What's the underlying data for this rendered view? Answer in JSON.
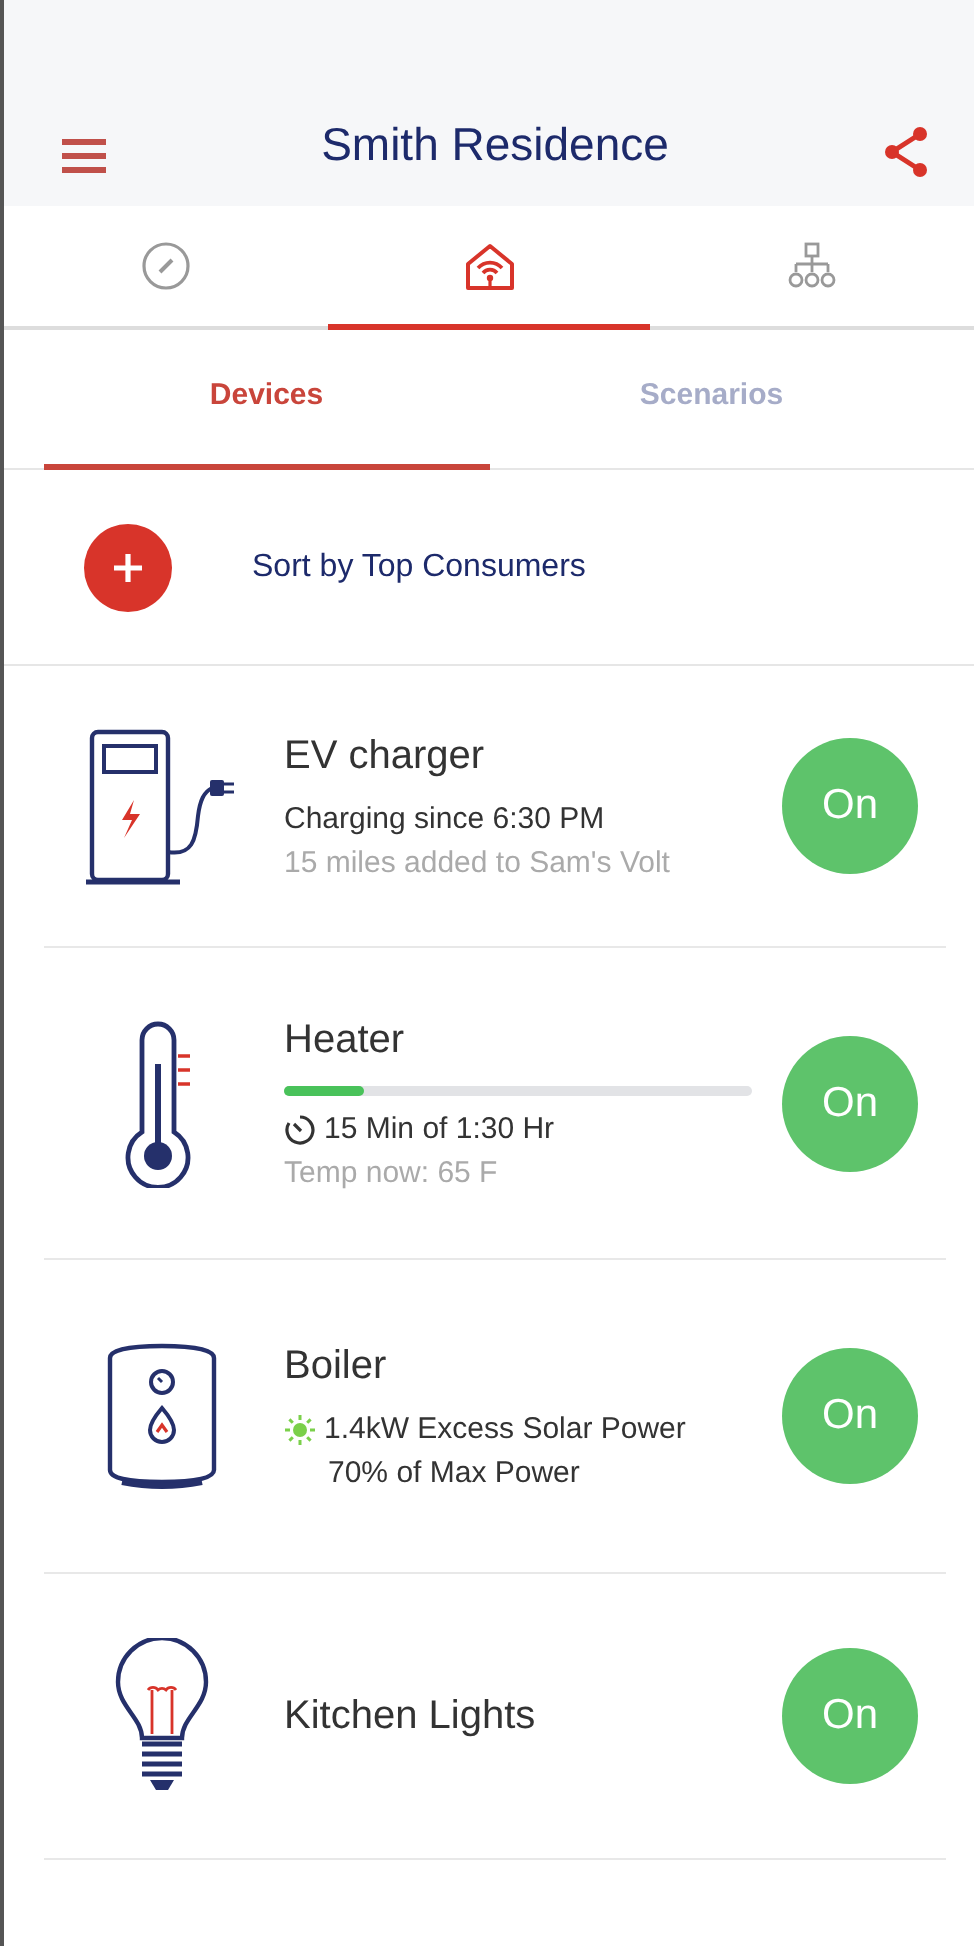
{
  "header": {
    "title": "Smith Residence"
  },
  "nav_tabs": [
    {
      "kind": "gauge",
      "selected": false
    },
    {
      "kind": "home",
      "selected": true
    },
    {
      "kind": "network",
      "selected": false
    }
  ],
  "sub_tabs": [
    {
      "label": "Devices",
      "selected": true
    },
    {
      "label": "Scenarios",
      "selected": false
    }
  ],
  "sort": {
    "label": "Sort by Top Consumers"
  },
  "devices": [
    {
      "kind": "charger",
      "name": "EV charger",
      "lines": [
        {
          "kind": "plain",
          "text": "Charging since 6:30 PM"
        },
        {
          "kind": "muted",
          "text": "15 miles added to Sam's Volt"
        }
      ],
      "toggle": "On",
      "on": true
    },
    {
      "kind": "thermometer",
      "name": "Heater",
      "level": 0.17,
      "lines": [
        {
          "kind": "timer",
          "text": "15 Min of 1:30 Hr"
        },
        {
          "kind": "muted",
          "text": "Temp now: 65 F"
        }
      ],
      "toggle": "On",
      "on": true
    },
    {
      "kind": "boiler",
      "name": "Boiler",
      "lines": [
        {
          "kind": "solar",
          "text": "1.4kW Excess Solar Power"
        },
        {
          "kind": "indented",
          "text": "70% of Max Power"
        }
      ],
      "toggle": "On",
      "on": true
    },
    {
      "kind": "bulb",
      "name": "Kitchen Lights",
      "toggle": "On",
      "on": true
    }
  ]
}
